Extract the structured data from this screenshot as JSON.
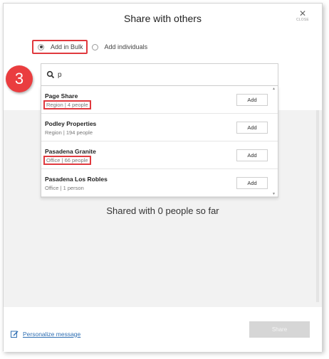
{
  "dialog": {
    "title": "Share with others",
    "close_label": "CLOSE"
  },
  "modes": {
    "bulk_label": "Add in Bulk",
    "individuals_label": "Add individuals",
    "selected": "bulk"
  },
  "step_badge": "3",
  "search": {
    "value": "p",
    "placeholder": ""
  },
  "results": [
    {
      "name": "Page Share",
      "meta": "Region | 4 people",
      "button": "Add",
      "highlighted": true
    },
    {
      "name": "Podley Properties",
      "meta": "Region | 194 people",
      "button": "Add",
      "highlighted": false
    },
    {
      "name": "Pasadena Granite",
      "meta": "Office | 66 people",
      "button": "Add",
      "highlighted": true
    },
    {
      "name": "Pasadena Los Robles",
      "meta": "Office | 1 person",
      "button": "Add",
      "highlighted": false
    }
  ],
  "status": "Shared with 0 people so far",
  "footer": {
    "personalize_label": "Personalize message",
    "share_label": "Share"
  },
  "icons": {
    "close": "close-icon",
    "search": "search-icon",
    "edit": "edit-icon"
  },
  "colors": {
    "highlight": "#e0393e",
    "badge": "#ea3d3f",
    "link": "#2f6fb3",
    "share_disabled": "#d6d6d6"
  }
}
